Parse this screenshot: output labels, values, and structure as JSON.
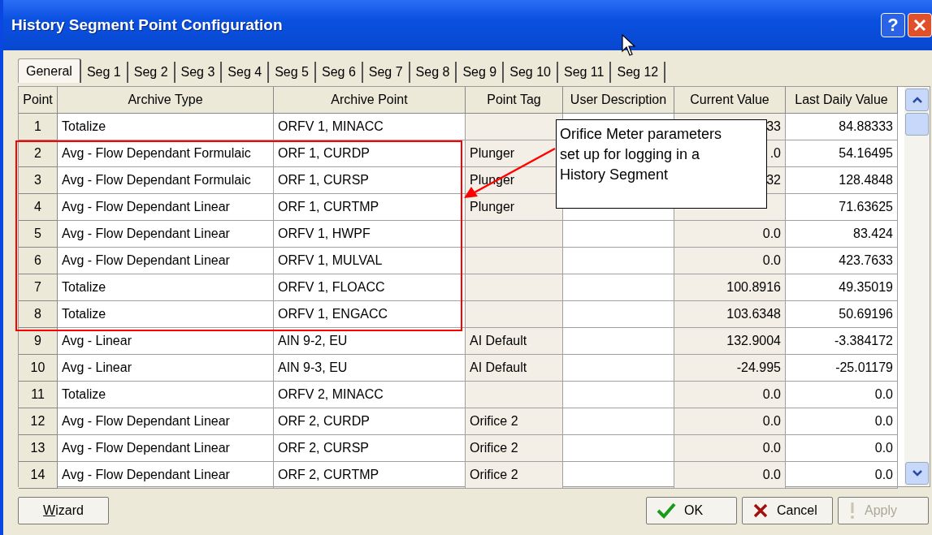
{
  "window": {
    "title": "History Segment Point Configuration",
    "help_label": "?"
  },
  "tabs": [
    {
      "label": "General",
      "selected": true
    },
    {
      "label": "Seg 1",
      "selected": false
    },
    {
      "label": "Seg 2",
      "selected": false
    },
    {
      "label": "Seg 3",
      "selected": false
    },
    {
      "label": "Seg 4",
      "selected": false
    },
    {
      "label": "Seg 5",
      "selected": false
    },
    {
      "label": "Seg 6",
      "selected": false
    },
    {
      "label": "Seg 7",
      "selected": false
    },
    {
      "label": "Seg 8",
      "selected": false
    },
    {
      "label": "Seg 9",
      "selected": false
    },
    {
      "label": "Seg 10",
      "selected": false
    },
    {
      "label": "Seg 11",
      "selected": false
    },
    {
      "label": "Seg 12",
      "selected": false
    }
  ],
  "table": {
    "columns": [
      "Point",
      "Archive Type",
      "Archive Point",
      "Point Tag",
      "User Description",
      "Current Value",
      "Last Daily Value"
    ],
    "rows": [
      {
        "point": "1",
        "archive_type": "Totalize",
        "archive_point": "ORFV 1, MINACC",
        "current_value": "33",
        "last_daily_value": "84.88333"
      },
      {
        "point": "2",
        "archive_type": "Avg - Flow Dependant Formulaic",
        "archive_point": "ORF 1, CURDP",
        "point_tag": "Plunger",
        "current_value": ".0",
        "last_daily_value": "54.16495"
      },
      {
        "point": "3",
        "archive_type": "Avg - Flow Dependant Formulaic",
        "archive_point": "ORF 1, CURSP",
        "point_tag": "Plunger",
        "current_value": "32",
        "last_daily_value": "128.4848"
      },
      {
        "point": "4",
        "archive_type": "Avg - Flow Dependant Linear",
        "archive_point": "ORF 1, CURTMP",
        "point_tag": "Plunger",
        "last_daily_value": "71.63625"
      },
      {
        "point": "5",
        "archive_type": "Avg - Flow Dependant Linear",
        "archive_point": "ORFV 1, HWPF",
        "current_value": "0.0",
        "last_daily_value": "83.424"
      },
      {
        "point": "6",
        "archive_type": "Avg - Flow Dependant Linear",
        "archive_point": "ORFV 1, MULVAL",
        "current_value": "0.0",
        "last_daily_value": "423.7633"
      },
      {
        "point": "7",
        "archive_type": "Totalize",
        "archive_point": "ORFV 1, FLOACC",
        "current_value": "100.8916",
        "last_daily_value": "49.35019"
      },
      {
        "point": "8",
        "archive_type": "Totalize",
        "archive_point": "ORFV 1, ENGACC",
        "current_value": "103.6348",
        "last_daily_value": "50.69196"
      },
      {
        "point": "9",
        "archive_type": "Avg - Linear",
        "archive_point": "AIN 9-2, EU",
        "point_tag": "AI Default",
        "current_value": "132.9004",
        "last_daily_value": "-3.384172"
      },
      {
        "point": "10",
        "archive_type": "Avg - Linear",
        "archive_point": "AIN 9-3, EU",
        "point_tag": "AI Default",
        "current_value": "-24.995",
        "last_daily_value": "-25.01179"
      },
      {
        "point": "11",
        "archive_type": "Totalize",
        "archive_point": "ORFV 2, MINACC",
        "current_value": "0.0",
        "last_daily_value": "0.0"
      },
      {
        "point": "12",
        "archive_type": "Avg - Flow Dependant Linear",
        "archive_point": "ORF 2, CURDP",
        "point_tag": "Orifice 2",
        "current_value": "0.0",
        "last_daily_value": "0.0"
      },
      {
        "point": "13",
        "archive_type": "Avg - Flow Dependant Linear",
        "archive_point": "ORF 2, CURSP",
        "point_tag": "Orifice 2",
        "current_value": "0.0",
        "last_daily_value": "0.0"
      },
      {
        "point": "14",
        "archive_type": "Avg - Flow Dependant Linear",
        "archive_point": "ORF 2, CURTMP",
        "point_tag": "Orifice 2",
        "current_value": "0.0",
        "last_daily_value": "0.0"
      }
    ]
  },
  "callout": {
    "text": "Orifice Meter parameters set up for logging in a History Segment"
  },
  "buttons": [
    {
      "kind": "wizard",
      "label": "Wizard",
      "disabled": false
    },
    {
      "kind": "ok",
      "label": "OK",
      "disabled": false
    },
    {
      "kind": "cancel",
      "label": "Cancel",
      "disabled": false
    },
    {
      "kind": "apply",
      "label": "Apply",
      "disabled": true
    }
  ]
}
